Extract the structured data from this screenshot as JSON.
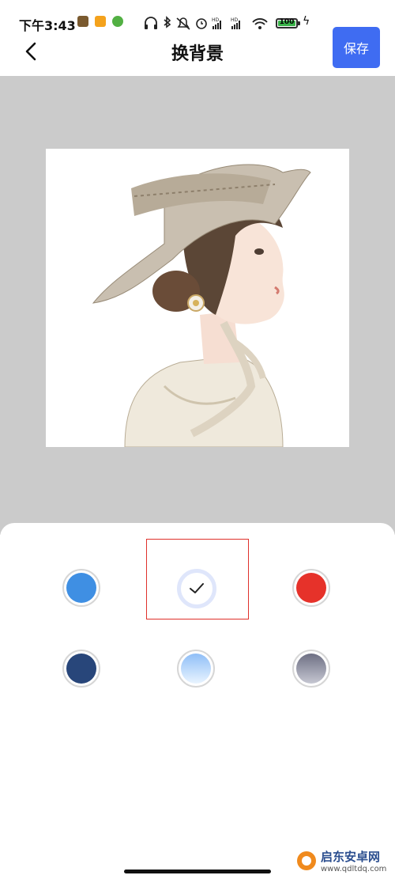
{
  "status_bar": {
    "time": "下午3:43",
    "battery": "100",
    "hd1": "HD",
    "hd2": "HD"
  },
  "header": {
    "title": "换背景",
    "save_label": "保存"
  },
  "colors": {
    "save_button": "#3f6cf2",
    "preview_bg": "#cbcbcb",
    "highlight": "#e0312b"
  },
  "swatches": [
    {
      "name": "blue",
      "color": "#3f8fe3",
      "selected": false
    },
    {
      "name": "white",
      "color": "#ffffff",
      "selected": true
    },
    {
      "name": "red",
      "color": "#e6322a",
      "selected": false
    },
    {
      "name": "dark-blue",
      "color": "#28467a",
      "selected": false
    },
    {
      "name": "light-blue-gradient",
      "color": "#b8d6fb",
      "selected": false
    },
    {
      "name": "gray-gradient",
      "color": "#7a7c90",
      "selected": false
    }
  ],
  "watermark": {
    "brand": "启东安卓网",
    "url": "www.qdltdq.com"
  }
}
